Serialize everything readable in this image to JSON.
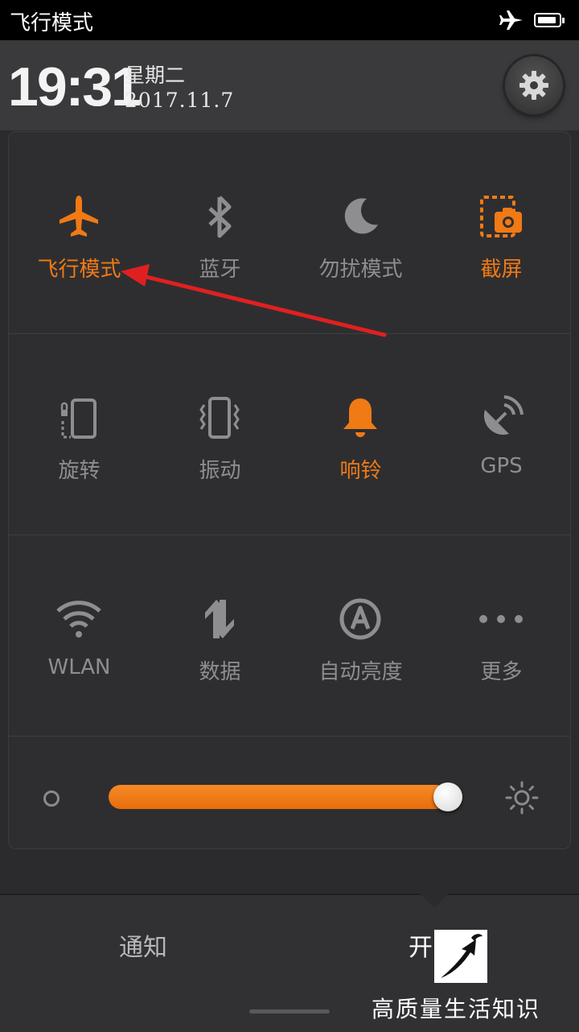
{
  "status_bar": {
    "title": "飞行模式",
    "icons": [
      "airplane-icon",
      "battery-icon"
    ]
  },
  "header": {
    "time": "19:31",
    "weekday": "星期二",
    "date": "2017.11.7",
    "settings_icon": "gear-icon"
  },
  "toggles": [
    {
      "label": "飞行模式",
      "icon": "airplane-icon",
      "on": true
    },
    {
      "label": "蓝牙",
      "icon": "bluetooth-icon",
      "on": false
    },
    {
      "label": "勿扰模式",
      "icon": "moon-icon",
      "on": false
    },
    {
      "label": "截屏",
      "icon": "screenshot-icon",
      "on": true
    },
    {
      "label": "旋转",
      "icon": "rotation-lock-icon",
      "on": false
    },
    {
      "label": "振动",
      "icon": "vibrate-icon",
      "on": false
    },
    {
      "label": "响铃",
      "icon": "bell-icon",
      "on": true
    },
    {
      "label": "GPS",
      "icon": "gps-icon",
      "on": false
    },
    {
      "label": "WLAN",
      "icon": "wifi-icon",
      "on": false
    },
    {
      "label": "数据",
      "icon": "mobile-data-icon",
      "on": false
    },
    {
      "label": "自动亮度",
      "icon": "auto-brightness-icon",
      "on": false
    },
    {
      "label": "更多",
      "icon": "more-icon",
      "on": false
    }
  ],
  "brightness": {
    "level": 0.96,
    "low_icon": "brightness-low-icon",
    "high_icon": "brightness-high-icon"
  },
  "tabs": {
    "notifications": "通知",
    "switches": "开"
  },
  "watermark": {
    "text": "高质量生活知识"
  },
  "colors": {
    "accent": "#f07a14",
    "inactive": "#8e8e90",
    "annotation_arrow": "#e02020"
  }
}
